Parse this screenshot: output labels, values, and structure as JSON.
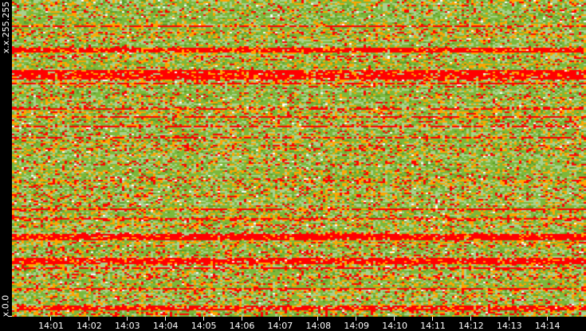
{
  "chart_data": {
    "type": "heatmap",
    "title": "",
    "xlabel": "",
    "ylabel": "",
    "x_ticks": [
      "14:01",
      "14:02",
      "14:03",
      "14:04",
      "14:05",
      "14:06",
      "14:07",
      "14:08",
      "14:09",
      "14:10",
      "14:11",
      "14:12",
      "14:13",
      "14:14"
    ],
    "y_ticks": [
      "x.x.255.255",
      "x.x.0.0"
    ],
    "color_scale": [
      "#ffffff",
      "#a9d18e",
      "#7cb83a",
      "#5f9e2a",
      "#ffa500",
      "#ff0000"
    ],
    "grid": false
  }
}
